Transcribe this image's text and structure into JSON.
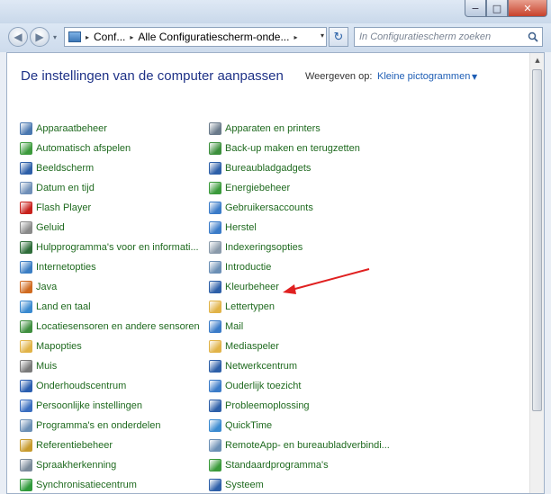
{
  "window": {
    "min_glyph": "−",
    "max_glyph": "□",
    "close_glyph": "✕"
  },
  "nav": {
    "back_glyph": "◀",
    "forward_glyph": "▶",
    "recent_glyph": "▾",
    "breadcrumbs": [
      "Conf...",
      "Alle Configuratiescherm-onde..."
    ],
    "crumb_sep": "▸",
    "dropdown_glyph": "▾",
    "refresh_glyph": "↻",
    "search_placeholder": "In Configuratiescherm zoeken"
  },
  "header": {
    "title": "De instellingen van de computer aanpassen",
    "view_label": "Weergeven op:",
    "view_value": "Kleine pictogrammen",
    "view_caret": "▼"
  },
  "items_left": [
    {
      "label": "Apparaatbeheer",
      "icon": "device-manager-icon",
      "color": "#4a78b0"
    },
    {
      "label": "Automatisch afspelen",
      "icon": "autoplay-icon",
      "color": "#3c9a3c"
    },
    {
      "label": "Beeldscherm",
      "icon": "display-icon",
      "color": "#2d5fa8"
    },
    {
      "label": "Datum en tijd",
      "icon": "clock-icon",
      "color": "#6f8fb8"
    },
    {
      "label": "Flash Player",
      "icon": "flash-icon",
      "color": "#c8211c"
    },
    {
      "label": "Geluid",
      "icon": "speaker-icon",
      "color": "#8a8a8a"
    },
    {
      "label": "Hulpprogramma's voor en informati...",
      "icon": "performance-icon",
      "color": "#2f6d3a"
    },
    {
      "label": "Internetopties",
      "icon": "internet-icon",
      "color": "#3b7ec4"
    },
    {
      "label": "Java",
      "icon": "java-icon",
      "color": "#d06a1f"
    },
    {
      "label": "Land en taal",
      "icon": "globe-icon",
      "color": "#3a8ad0"
    },
    {
      "label": "Locatiesensoren en andere sensoren",
      "icon": "sensor-icon",
      "color": "#3f8f3f"
    },
    {
      "label": "Mapopties",
      "icon": "folder-options-icon",
      "color": "#e1b347"
    },
    {
      "label": "Muis",
      "icon": "mouse-icon",
      "color": "#7a7a7a"
    },
    {
      "label": "Onderhoudscentrum",
      "icon": "flag-icon",
      "color": "#2a5eb0"
    },
    {
      "label": "Persoonlijke instellingen",
      "icon": "personalization-icon",
      "color": "#3a6ec0"
    },
    {
      "label": "Programma's en onderdelen",
      "icon": "programs-icon",
      "color": "#6b8fb5"
    },
    {
      "label": "Referentiebeheer",
      "icon": "credential-icon",
      "color": "#c79a2c"
    },
    {
      "label": "Spraakherkenning",
      "icon": "microphone-icon",
      "color": "#7a8a9a"
    },
    {
      "label": "Synchronisatiecentrum",
      "icon": "sync-icon",
      "color": "#2f9a3a"
    }
  ],
  "items_right": [
    {
      "label": "Apparaten en printers",
      "icon": "printer-icon",
      "color": "#6a7a8a"
    },
    {
      "label": "Back-up maken en terugzetten",
      "icon": "backup-icon",
      "color": "#3c8f3c"
    },
    {
      "label": "Bureaubladgadgets",
      "icon": "gadgets-icon",
      "color": "#2d5fa8"
    },
    {
      "label": "Energiebeheer",
      "icon": "power-icon",
      "color": "#3a9a3a"
    },
    {
      "label": "Gebruikersaccounts",
      "icon": "users-icon",
      "color": "#3a7bc8"
    },
    {
      "label": "Herstel",
      "icon": "recovery-icon",
      "color": "#3a7bc8"
    },
    {
      "label": "Indexeringsopties",
      "icon": "index-icon",
      "color": "#8a9aaa"
    },
    {
      "label": "Introductie",
      "icon": "getting-started-icon",
      "color": "#6b8fb5"
    },
    {
      "label": "Kleurbeheer",
      "icon": "color-management-icon",
      "color": "#2d5fa8"
    },
    {
      "label": "Lettertypen",
      "icon": "fonts-icon",
      "color": "#e1b347"
    },
    {
      "label": "Mail",
      "icon": "mail-icon",
      "color": "#3a7bc8"
    },
    {
      "label": "Mediaspeler",
      "icon": "media-player-icon",
      "color": "#e1b347"
    },
    {
      "label": "Netwerkcentrum",
      "icon": "network-icon",
      "color": "#2d5fa8"
    },
    {
      "label": "Ouderlijk toezicht",
      "icon": "parental-controls-icon",
      "color": "#3a7bc8"
    },
    {
      "label": "Probleemoplossing",
      "icon": "troubleshooting-icon",
      "color": "#2d5fa8"
    },
    {
      "label": "QuickTime",
      "icon": "quicktime-icon",
      "color": "#3a8ad0"
    },
    {
      "label": "RemoteApp- en bureaubladverbindi...",
      "icon": "remoteapp-icon",
      "color": "#6b8fb5"
    },
    {
      "label": "Standaardprogramma's",
      "icon": "default-programs-icon",
      "color": "#3a9a3a"
    },
    {
      "label": "Systeem",
      "icon": "system-icon",
      "color": "#2d5fa8"
    }
  ],
  "annotation": {
    "arrow_color": "#e02020"
  }
}
